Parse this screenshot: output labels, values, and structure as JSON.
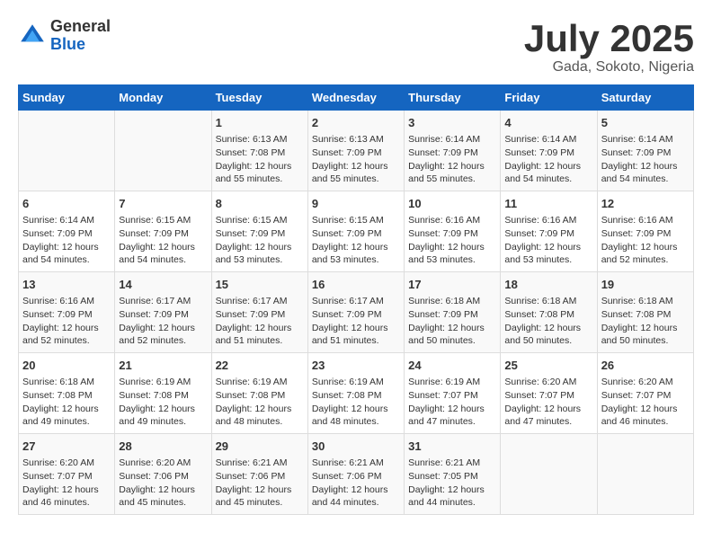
{
  "header": {
    "logo_general": "General",
    "logo_blue": "Blue",
    "month_title": "July 2025",
    "location": "Gada, Sokoto, Nigeria"
  },
  "days_of_week": [
    "Sunday",
    "Monday",
    "Tuesday",
    "Wednesday",
    "Thursday",
    "Friday",
    "Saturday"
  ],
  "weeks": [
    [
      {
        "day": "",
        "detail": ""
      },
      {
        "day": "",
        "detail": ""
      },
      {
        "day": "1",
        "detail": "Sunrise: 6:13 AM\nSunset: 7:08 PM\nDaylight: 12 hours and 55 minutes."
      },
      {
        "day": "2",
        "detail": "Sunrise: 6:13 AM\nSunset: 7:09 PM\nDaylight: 12 hours and 55 minutes."
      },
      {
        "day": "3",
        "detail": "Sunrise: 6:14 AM\nSunset: 7:09 PM\nDaylight: 12 hours and 55 minutes."
      },
      {
        "day": "4",
        "detail": "Sunrise: 6:14 AM\nSunset: 7:09 PM\nDaylight: 12 hours and 54 minutes."
      },
      {
        "day": "5",
        "detail": "Sunrise: 6:14 AM\nSunset: 7:09 PM\nDaylight: 12 hours and 54 minutes."
      }
    ],
    [
      {
        "day": "6",
        "detail": "Sunrise: 6:14 AM\nSunset: 7:09 PM\nDaylight: 12 hours and 54 minutes."
      },
      {
        "day": "7",
        "detail": "Sunrise: 6:15 AM\nSunset: 7:09 PM\nDaylight: 12 hours and 54 minutes."
      },
      {
        "day": "8",
        "detail": "Sunrise: 6:15 AM\nSunset: 7:09 PM\nDaylight: 12 hours and 53 minutes."
      },
      {
        "day": "9",
        "detail": "Sunrise: 6:15 AM\nSunset: 7:09 PM\nDaylight: 12 hours and 53 minutes."
      },
      {
        "day": "10",
        "detail": "Sunrise: 6:16 AM\nSunset: 7:09 PM\nDaylight: 12 hours and 53 minutes."
      },
      {
        "day": "11",
        "detail": "Sunrise: 6:16 AM\nSunset: 7:09 PM\nDaylight: 12 hours and 53 minutes."
      },
      {
        "day": "12",
        "detail": "Sunrise: 6:16 AM\nSunset: 7:09 PM\nDaylight: 12 hours and 52 minutes."
      }
    ],
    [
      {
        "day": "13",
        "detail": "Sunrise: 6:16 AM\nSunset: 7:09 PM\nDaylight: 12 hours and 52 minutes."
      },
      {
        "day": "14",
        "detail": "Sunrise: 6:17 AM\nSunset: 7:09 PM\nDaylight: 12 hours and 52 minutes."
      },
      {
        "day": "15",
        "detail": "Sunrise: 6:17 AM\nSunset: 7:09 PM\nDaylight: 12 hours and 51 minutes."
      },
      {
        "day": "16",
        "detail": "Sunrise: 6:17 AM\nSunset: 7:09 PM\nDaylight: 12 hours and 51 minutes."
      },
      {
        "day": "17",
        "detail": "Sunrise: 6:18 AM\nSunset: 7:09 PM\nDaylight: 12 hours and 50 minutes."
      },
      {
        "day": "18",
        "detail": "Sunrise: 6:18 AM\nSunset: 7:08 PM\nDaylight: 12 hours and 50 minutes."
      },
      {
        "day": "19",
        "detail": "Sunrise: 6:18 AM\nSunset: 7:08 PM\nDaylight: 12 hours and 50 minutes."
      }
    ],
    [
      {
        "day": "20",
        "detail": "Sunrise: 6:18 AM\nSunset: 7:08 PM\nDaylight: 12 hours and 49 minutes."
      },
      {
        "day": "21",
        "detail": "Sunrise: 6:19 AM\nSunset: 7:08 PM\nDaylight: 12 hours and 49 minutes."
      },
      {
        "day": "22",
        "detail": "Sunrise: 6:19 AM\nSunset: 7:08 PM\nDaylight: 12 hours and 48 minutes."
      },
      {
        "day": "23",
        "detail": "Sunrise: 6:19 AM\nSunset: 7:08 PM\nDaylight: 12 hours and 48 minutes."
      },
      {
        "day": "24",
        "detail": "Sunrise: 6:19 AM\nSunset: 7:07 PM\nDaylight: 12 hours and 47 minutes."
      },
      {
        "day": "25",
        "detail": "Sunrise: 6:20 AM\nSunset: 7:07 PM\nDaylight: 12 hours and 47 minutes."
      },
      {
        "day": "26",
        "detail": "Sunrise: 6:20 AM\nSunset: 7:07 PM\nDaylight: 12 hours and 46 minutes."
      }
    ],
    [
      {
        "day": "27",
        "detail": "Sunrise: 6:20 AM\nSunset: 7:07 PM\nDaylight: 12 hours and 46 minutes."
      },
      {
        "day": "28",
        "detail": "Sunrise: 6:20 AM\nSunset: 7:06 PM\nDaylight: 12 hours and 45 minutes."
      },
      {
        "day": "29",
        "detail": "Sunrise: 6:21 AM\nSunset: 7:06 PM\nDaylight: 12 hours and 45 minutes."
      },
      {
        "day": "30",
        "detail": "Sunrise: 6:21 AM\nSunset: 7:06 PM\nDaylight: 12 hours and 44 minutes."
      },
      {
        "day": "31",
        "detail": "Sunrise: 6:21 AM\nSunset: 7:05 PM\nDaylight: 12 hours and 44 minutes."
      },
      {
        "day": "",
        "detail": ""
      },
      {
        "day": "",
        "detail": ""
      }
    ]
  ]
}
